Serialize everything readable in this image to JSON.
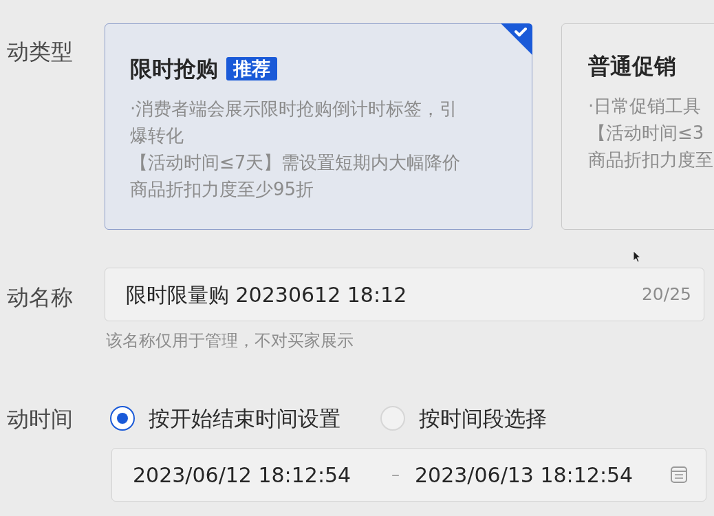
{
  "activity_type": {
    "label": "动类型",
    "cards": [
      {
        "title": "限时抢购",
        "badge": "推荐",
        "selected": true,
        "lines": [
          "·消费者端会展示限时抢购倒计时标签，引爆转化",
          "【活动时间≤7天】需设置短期内大幅降价",
          "商品折扣力度至少95折"
        ]
      },
      {
        "title": "普通促销",
        "selected": false,
        "lines": [
          "·日常促销工具",
          "【活动时间≤3",
          "商品折扣力度至"
        ]
      }
    ]
  },
  "activity_name": {
    "label": "动名称",
    "value": "限时限量购 20230612 18:12",
    "counter": "20/25",
    "hint": "该名称仅用于管理，不对买家展示"
  },
  "activity_time": {
    "label": "动时间",
    "options": [
      {
        "label": "按开始结束时间设置",
        "selected": true
      },
      {
        "label": "按时间段选择",
        "selected": false
      }
    ],
    "range": {
      "start": "2023/06/12 18:12:54",
      "separator": "–",
      "end": "2023/06/13 18:12:54"
    }
  }
}
